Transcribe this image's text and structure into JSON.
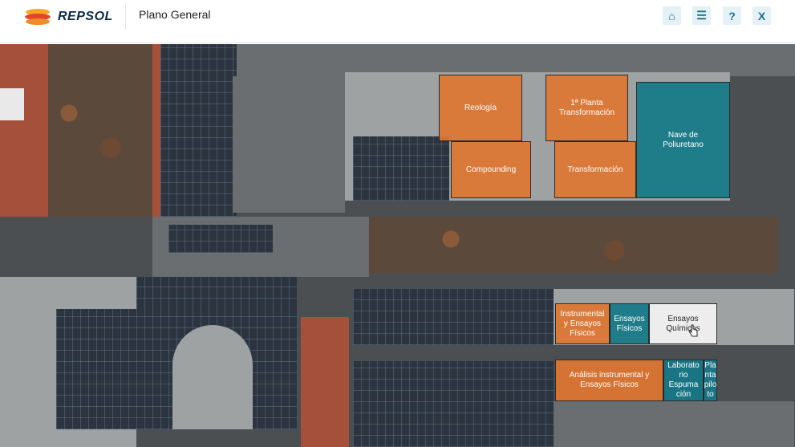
{
  "header": {
    "brand": "REPSOL",
    "title": "Plano General"
  },
  "toolbar": {
    "buttons": [
      {
        "name": "home",
        "icon": "home-icon",
        "glyph": "⌂"
      },
      {
        "name": "menu",
        "icon": "menu-icon",
        "glyph": "☰"
      },
      {
        "name": "help",
        "icon": "help-icon",
        "glyph": "?"
      },
      {
        "name": "close",
        "icon": "close-icon",
        "glyph": "X"
      }
    ]
  },
  "zones": {
    "reologia": "Reología",
    "primera_planta": "1ª Planta\nTransformación",
    "compounding": "Compounding",
    "transformacion": "Transformación",
    "nave_poliuretano": "Nave de\nPoliuretano",
    "instrumental": "Instrumental\ny Ensayos\nFísicos",
    "ensayos_fisicos": "Ensayos\nFísicos",
    "ensayos_quimicos": "Ensayos\nQuímicos",
    "analisis": "Análisis instrumental y\nEnsayos Físicos",
    "laboratorio": "Laborato\nrio\nEspuma\nción",
    "planta_piloto": "Pla\nnta\npilo\nto"
  },
  "colors": {
    "orange_zone": "#df7631",
    "teal_zone": "#167887",
    "selected_zone": "#f0f0f0",
    "brand_dark": "#0b2a4a",
    "button_bg": "#e4f1f6",
    "button_fg": "#1e6f8c"
  }
}
